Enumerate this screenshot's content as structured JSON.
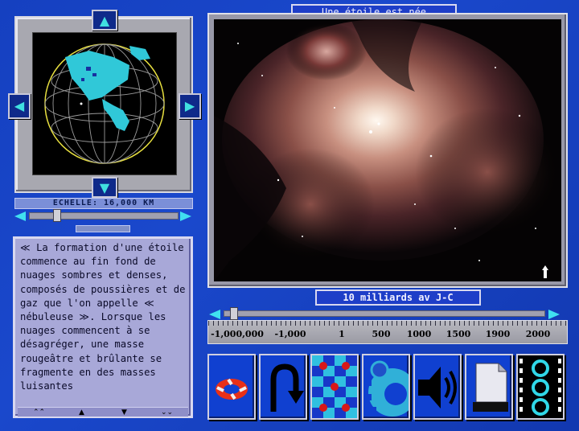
{
  "title": "Une étoile est née",
  "globe": {
    "scale_label": "ECHELLE: 16,000 KM",
    "arrow_up": "▲",
    "arrow_down": "▼",
    "arrow_left": "◀",
    "arrow_right": "▶"
  },
  "description": "≪ La formation d'une étoile commence au fin fond de nuages sombres et denses, composés de poussières et de gaz que l'on appelle ≪ nébuleuse ≫. Lorsque les nuages commencent à se désagréger, une masse rougeâtre et brûlante se fragmente en des masses luisantes",
  "text_nav": {
    "first": "⌃⌃",
    "prev": "▲",
    "next": "▼",
    "last": "⌄⌄"
  },
  "timeline": {
    "current_date": "10 milliards av J-C",
    "ticks": [
      "-1,000,000",
      "-1,000",
      "1",
      "500",
      "1000",
      "1500",
      "1900",
      "2000"
    ]
  },
  "tools": [
    {
      "name": "lifebuoy-icon"
    },
    {
      "name": "u-turn-arrow-icon"
    },
    {
      "name": "checkerboard-icon"
    },
    {
      "name": "gear-icon"
    },
    {
      "name": "speaker-icon"
    },
    {
      "name": "document-icon"
    },
    {
      "name": "film-strip-icon"
    }
  ],
  "colors": {
    "background": "#1540c0",
    "accent": "#40e0f0",
    "panel": "#a8a8d8"
  }
}
